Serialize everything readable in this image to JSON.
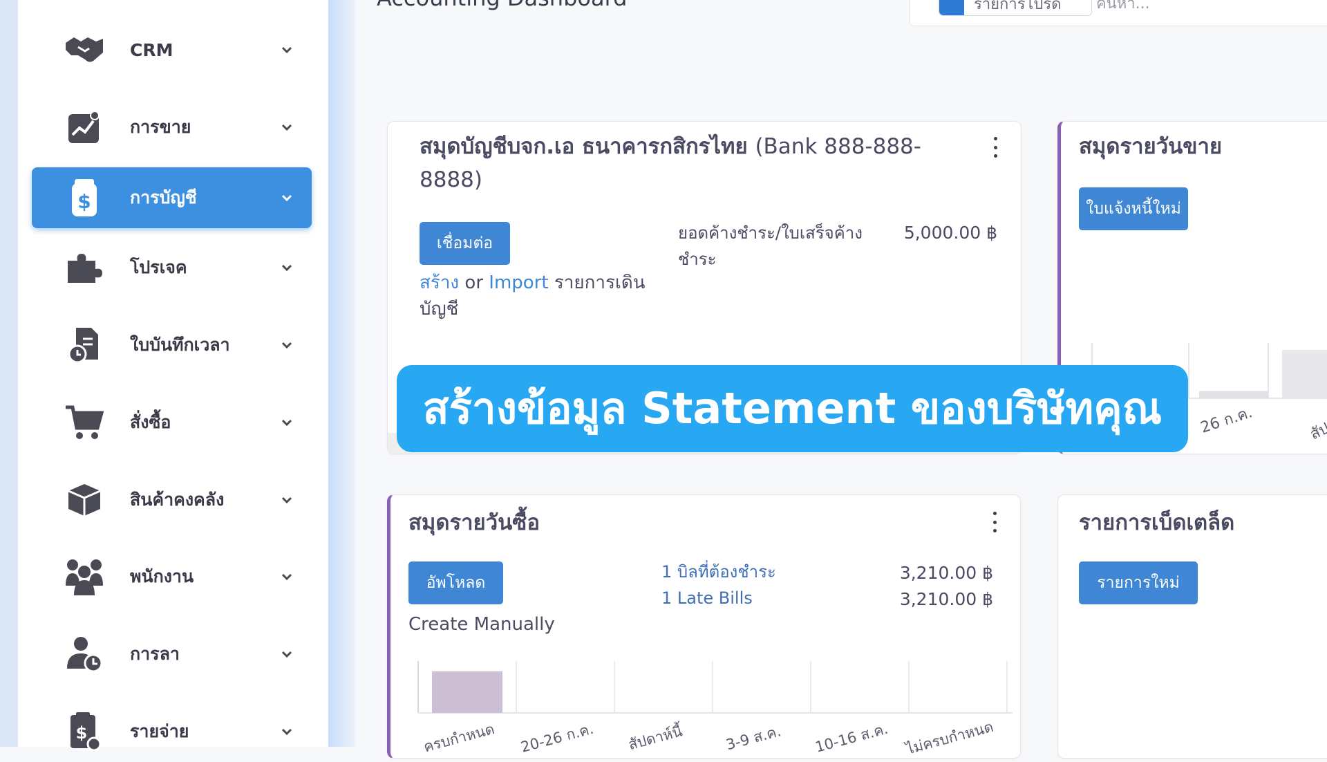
{
  "sidebar": {
    "items": [
      {
        "label": "CRM",
        "icon": "handshake-icon"
      },
      {
        "label": "การขาย",
        "icon": "sales-chart-icon"
      },
      {
        "label": "การบัญชี",
        "icon": "dollar-bag-icon",
        "active": true
      },
      {
        "label": "โปรเจค",
        "icon": "puzzle-icon"
      },
      {
        "label": "ใบบันทึกเวลา",
        "icon": "timesheet-icon"
      },
      {
        "label": "สั่งซื้อ",
        "icon": "cart-icon"
      },
      {
        "label": "สินค้าคงคลัง",
        "icon": "box-icon"
      },
      {
        "label": "พนักงาน",
        "icon": "team-icon"
      },
      {
        "label": "การลา",
        "icon": "person-clock-icon"
      },
      {
        "label": "รายจ่าย",
        "icon": "receipt-dollar-icon"
      }
    ]
  },
  "header": {
    "title": "Accounting Dashboard",
    "filter_label": "รายการโปรด",
    "search_placeholder": "ค้นหา..."
  },
  "cards": {
    "bank": {
      "title": "สมุดบัญชีบจก.เอ ธนาคารกสิกรไทย",
      "title_suffix": "(Bank 888-888-8888)",
      "button": "เชื่อมต่อ",
      "link_a": "สร้าง",
      "link_or": " or ",
      "link_b": "Import",
      "link_c": " รายการเดินบัญชี",
      "stat_label": "ยอดค้างชำระ/ใบเสร็จค้างชำระ",
      "stat_value": "5,000.00 ฿"
    },
    "sales": {
      "title": "สมุดรายวันขาย",
      "button": "ใบแจ้งหนี้ใหม่",
      "axis_labels": [
        "26 ก.ค.",
        "สัปดาห์นี้"
      ],
      "bar_values": [
        0.15,
        1.0
      ]
    },
    "purchase": {
      "title": "สมุดรายวันซื้อ",
      "button": "อัพโหลด",
      "link": "Create Manually",
      "stat1_label": "1 บิลที่ต้องชำระ",
      "stat1_value": "3,210.00 ฿",
      "stat2_label": "1 Late Bills",
      "stat2_value": "3,210.00 ฿",
      "axis_labels": [
        "ครบกำหนด",
        "20-26 ก.ค.",
        "สัปดาห์นี้",
        "3-9 ส.ค.",
        "10-16 ส.ค.",
        "ไม่ครบกำหนด"
      ],
      "bar_values": [
        1,
        0,
        0,
        0,
        0,
        0
      ]
    },
    "misc": {
      "title": "รายการเบ็ดเตล็ด",
      "button": "รายการใหม่"
    }
  },
  "banner": {
    "text": "สร้างข้อมูล Statement ของบริษัทคุณ"
  },
  "colors": {
    "accent": "#3d8fe0",
    "button": "#3f86d4",
    "banner": "#28a8f2",
    "card_accent": "#8a5fb8",
    "bar": "#cdbfd3"
  }
}
